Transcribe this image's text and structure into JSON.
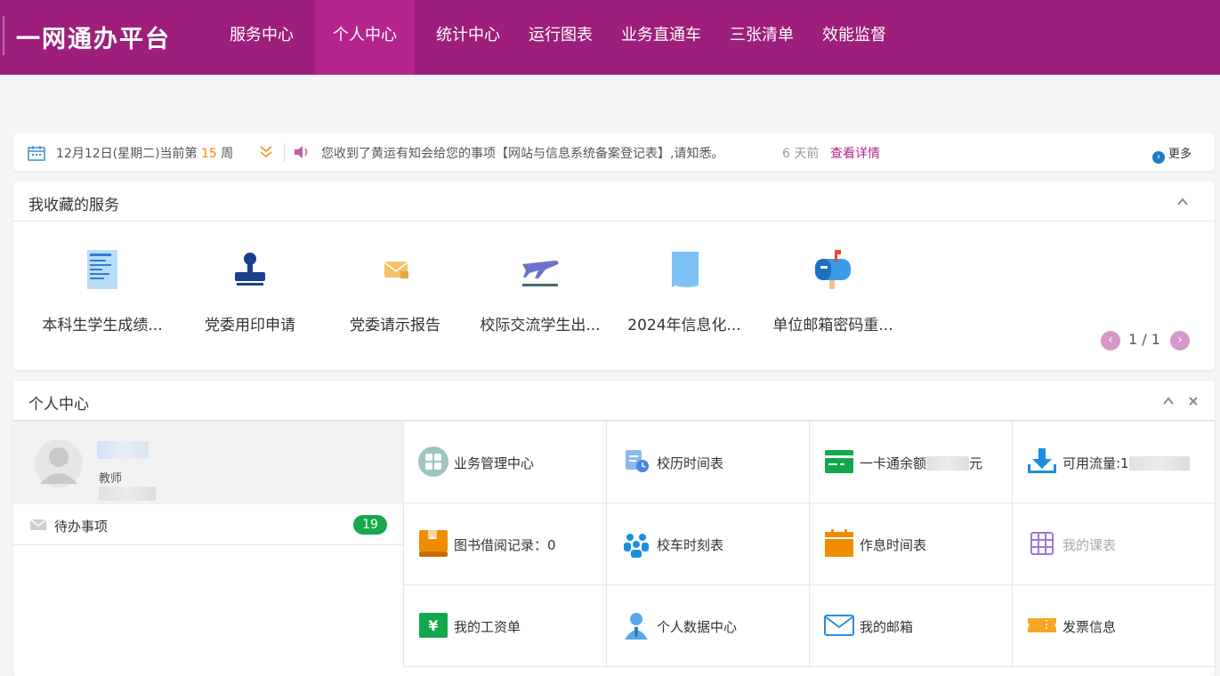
{
  "header": {
    "logo": "一网通办平台",
    "nav": [
      "服务中心",
      "个人中心",
      "统计中心",
      "运行图表",
      "业务直通车",
      "三张清单",
      "效能监督"
    ],
    "active_index": 1
  },
  "notice": {
    "date_prefix": "12月12日(星期二)当前第",
    "week": "15",
    "week_suffix": "周",
    "message": "您收到了黄运有知会给您的事项【网站与信息系统备案登记表】,请知悉。",
    "ago": "6 天前",
    "detail": "查看详情",
    "more": "更多"
  },
  "favorites": {
    "title": "我收藏的服务",
    "items": [
      {
        "label": "本科生学生成绩...",
        "icon": "document-icon"
      },
      {
        "label": "党委用印申请",
        "icon": "stamp-icon"
      },
      {
        "label": "党委请示报告",
        "icon": "envelope-lock-icon"
      },
      {
        "label": "校际交流学生出...",
        "icon": "airplane-icon"
      },
      {
        "label": "2024年信息化...",
        "icon": "paper-icon"
      },
      {
        "label": "单位邮箱密码重...",
        "icon": "mailbox-icon"
      }
    ],
    "pager": "1 / 1"
  },
  "personal": {
    "title": "个人中心",
    "role": "教师",
    "todo_label": "待办事项",
    "todo_count": "19",
    "cells": [
      {
        "label": "业务管理中心",
        "icon": "grid-apps-icon"
      },
      {
        "label": "校历时间表",
        "icon": "clipboard-clock-icon"
      },
      {
        "label": "一卡通余额",
        "suffix": "元",
        "icon": "card-icon"
      },
      {
        "label": "可用流量:1",
        "icon": "download-icon"
      },
      {
        "label": "图书借阅记录：0",
        "icon": "book-icon"
      },
      {
        "label": "校车时刻表",
        "icon": "people-icon"
      },
      {
        "label": "作息时间表",
        "icon": "calendar-icon"
      },
      {
        "label": "我的课表",
        "icon": "table-icon"
      },
      {
        "label": "我的工资单",
        "icon": "yen-icon"
      },
      {
        "label": "个人数据中心",
        "icon": "user-icon"
      },
      {
        "label": "我的邮箱",
        "icon": "mail-icon"
      },
      {
        "label": "发票信息",
        "icon": "ticket-icon"
      }
    ]
  }
}
